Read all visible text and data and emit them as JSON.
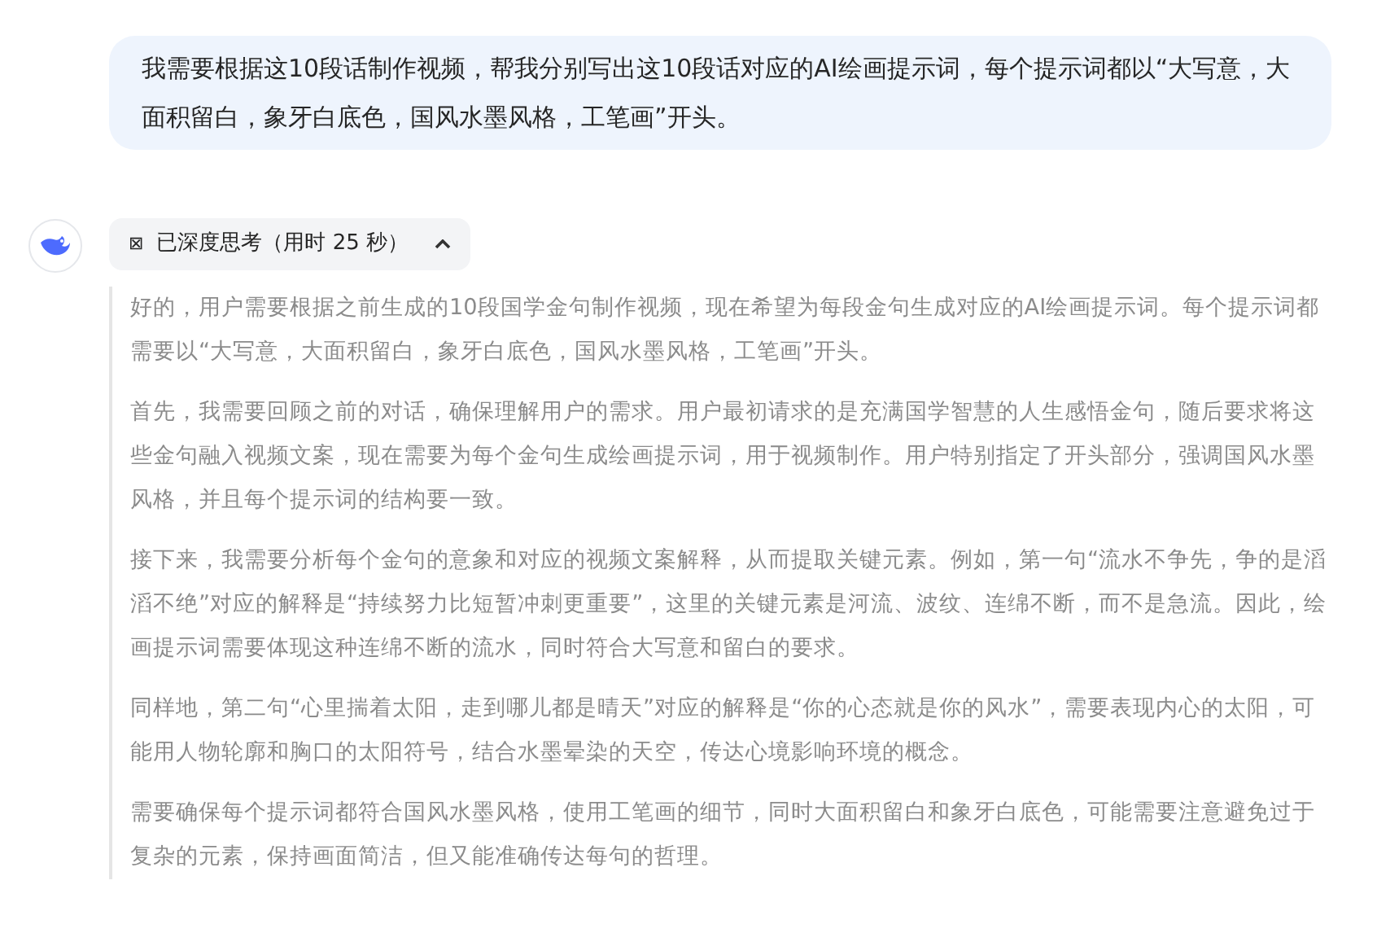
{
  "user_message": {
    "text": "我需要根据这10段话制作视频，帮我分别写出这10段话对应的AI绘画提示词，每个提示词都以“大写意，大面积留白，象牙白底色，国风水墨风格，工笔画”开头。"
  },
  "thinking": {
    "icon_text": "⊠",
    "label": "已深度思考（用时 25 秒）",
    "expanded": true,
    "paragraphs": [
      "好的，用户需要根据之前生成的10段国学金句制作视频，现在希望为每段金句生成对应的AI绘画提示词。每个提示词都需要以“大写意，大面积留白，象牙白底色，国风水墨风格，工笔画”开头。",
      "首先，我需要回顾之前的对话，确保理解用户的需求。用户最初请求的是充满国学智慧的人生感悟金句，随后要求将这些金句融入视频文案，现在需要为每个金句生成绘画提示词，用于视频制作。用户特别指定了开头部分，强调国风水墨风格，并且每个提示词的结构要一致。",
      "接下来，我需要分析每个金句的意象和对应的视频文案解释，从而提取关键元素。例如，第一句“流水不争先，争的是滔滔不绝”对应的解释是“持续努力比短暂冲刺更重要”，这里的关键元素是河流、波纹、连绵不断，而不是急流。因此，绘画提示词需要体现这种连绵不断的流水，同时符合大写意和留白的要求。",
      "同样地，第二句“心里揣着太阳，走到哪儿都是晴天”对应的解释是“你的心态就是你的风水”，需要表现内心的太阳，可能用人物轮廓和胸口的太阳符号，结合水墨晕染的天空，传达心境影响环境的概念。",
      "需要确保每个提示词都符合国风水墨风格，使用工笔画的细节，同时大面积留白和象牙白底色，可能需要注意避免过于复杂的元素，保持画面简洁，但又能准确传达每句的哲理。"
    ]
  }
}
